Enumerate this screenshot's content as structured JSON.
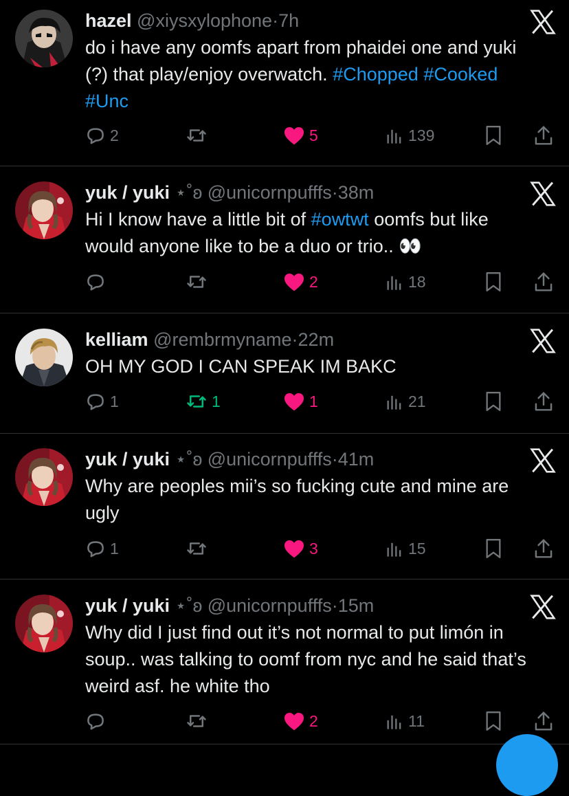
{
  "colors": {
    "background": "#000000",
    "text": "#e7e9ea",
    "muted": "#71767b",
    "hashtag": "#1d9bf0",
    "like": "#f91880",
    "repost": "#00ba7c",
    "divider": "#2f3336"
  },
  "tweets": [
    {
      "name": "hazel",
      "decor": "",
      "handle": "@xiysxylophone",
      "dot": "·",
      "time": "7h",
      "text_before": "do i have any oomfs apart from phaidei one and yuki (?) that play/enjoy overwatch. ",
      "hashtags": [
        "#Chopped",
        "#Cooked",
        "#Unc"
      ],
      "text_after": "",
      "replies": "2",
      "reposts": "",
      "likes": "5",
      "views": "139",
      "liked": true,
      "reposted": false,
      "avatar": "avatar-dark-hair"
    },
    {
      "name": "yuk / yuki",
      "decor": "⋆˚ʚ",
      "handle": "@unicornpufffs",
      "dot": "·",
      "time": "38m",
      "text_before": "Hi I know have a little bit of ",
      "hashtags": [
        "#owtwt"
      ],
      "text_after": " oomfs but like would anyone like to be a duo or trio.. 👀",
      "replies": "",
      "reposts": "",
      "likes": "2",
      "views": "18",
      "liked": true,
      "reposted": false,
      "avatar": "avatar-brown-hair-red"
    },
    {
      "name": "kelliam",
      "decor": "",
      "handle": "@rembrmyname",
      "dot": "·",
      "time": "22m",
      "text_before": "OH MY GOD I CAN SPEAK IM BAKC",
      "hashtags": [],
      "text_after": "",
      "replies": "1",
      "reposts": "1",
      "likes": "1",
      "views": "21",
      "liked": true,
      "reposted": true,
      "avatar": "avatar-blond-hair"
    },
    {
      "name": "yuk / yuki",
      "decor": "⋆˚ʚ",
      "handle": "@unicornpufffs",
      "dot": "·",
      "time": "41m",
      "text_before": "Why are peoples mii’s so fucking cute and mine are ugly",
      "hashtags": [],
      "text_after": "",
      "replies": "1",
      "reposts": "",
      "likes": "3",
      "views": "15",
      "liked": true,
      "reposted": false,
      "avatar": "avatar-brown-hair-red"
    },
    {
      "name": "yuk / yuki",
      "decor": "⋆˚ʚ",
      "handle": "@unicornpufffs",
      "dot": "·",
      "time": "15m",
      "text_before": "Why did I just find out it’s not normal to put limón in soup.. was talking to oomf from nyc and he said that’s weird asf. he white tho",
      "hashtags": [],
      "text_after": "",
      "replies": "",
      "reposts": "",
      "likes": "2",
      "views": "11",
      "liked": true,
      "reposted": false,
      "avatar": "avatar-brown-hair-red"
    }
  ]
}
